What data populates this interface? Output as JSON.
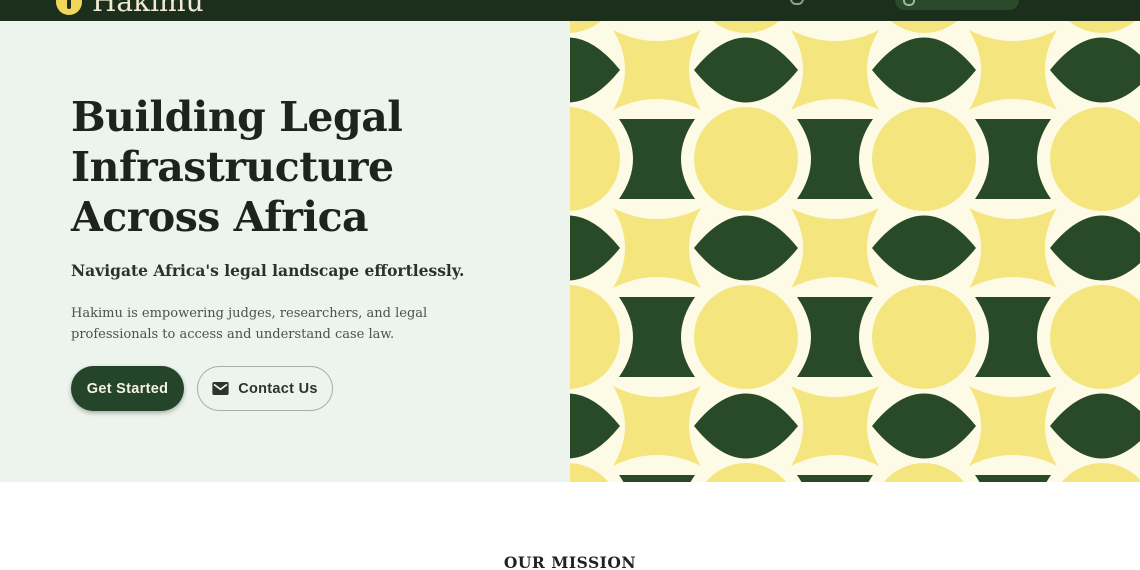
{
  "header": {
    "brand": "Hakimu"
  },
  "hero": {
    "title": "Building Legal Infrastructure Across Africa",
    "subtitle": "Navigate Africa's legal landscape effortlessly.",
    "description": "Hakimu is empowering judges, researchers, and legal professionals to access and understand case law.",
    "primary_button": "Get Started",
    "secondary_button": "Contact Us",
    "secondary_icon": "mail-icon"
  },
  "pattern": {
    "colors": {
      "green": "#284a26",
      "yellow": "#f5e57f",
      "background": "#fdfbe6"
    }
  },
  "colors": {
    "header_bg": "#1c2e1c",
    "hero_bg": "#edf4ed",
    "primary": "#25452a",
    "accent": "#f2d659"
  },
  "mission": {
    "heading": "OUR MISSION"
  }
}
